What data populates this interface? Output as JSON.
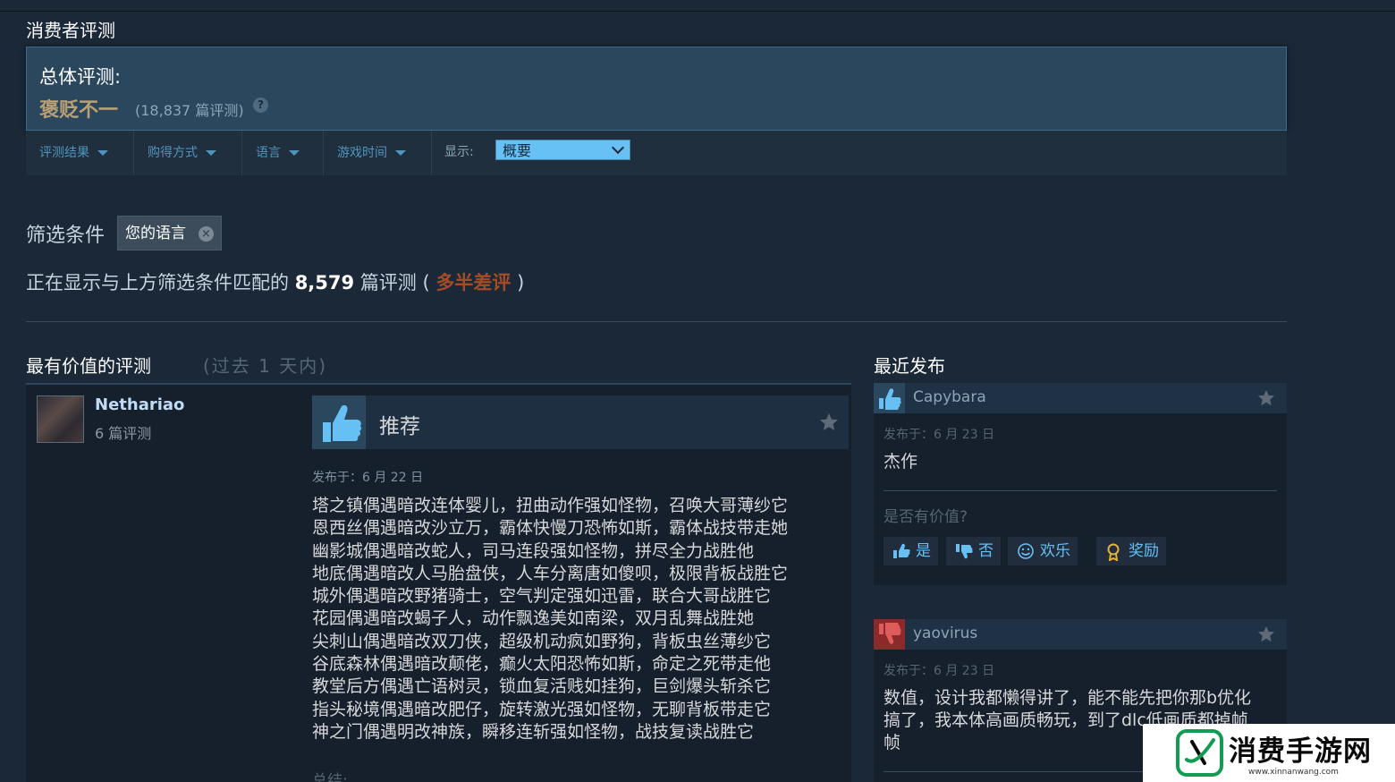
{
  "section_title": "消费者评测",
  "overall": {
    "label": "总体评测:",
    "summary": "褒贬不一",
    "count": "(18,837 篇评测)",
    "help": "?"
  },
  "filter_bar": {
    "items": [
      "评测结果",
      "购得方式",
      "语言",
      "游戏时间"
    ],
    "display_label": "显示:",
    "display_value": "概要"
  },
  "filters": {
    "label": "筛选条件",
    "chip": "您的语言",
    "chip_close": "×"
  },
  "showing": {
    "prefix": "正在显示与上方筛选条件匹配的",
    "count": "8,579",
    "unit": "篇评测 (",
    "summary": "多半差评",
    "suffix": ")"
  },
  "most_helpful": {
    "title": "最有价值的评测",
    "subtitle": "(过去 1 天内)"
  },
  "recent_title": "最近发布",
  "review": {
    "reviewer": "Nethariao",
    "reviewer_count": "6 篇评测",
    "verdict": "推荐",
    "posted": "发布于：6 月 22 日",
    "body": "塔之镇偶遇暗改连体婴儿，扭曲动作强如怪物，召唤大哥薄纱它\n恩西丝偶遇暗改沙立万，霸体快慢刀恐怖如斯，霸体战技带走她\n幽影城偶遇暗改蛇人，司马连段强如怪物，拼尽全力战胜他\n地底偶遇暗改人马胎盘侠，人车分离唐如傻呗，极限背板战胜它\n城外偶遇暗改野猪骑士，空气判定强如迅雷，联合大哥战胜它\n花园偶遇暗改蝎子人，动作飘逸美如南梁，双月乱舞战胜她\n尖刺山偶遇暗改双刀侠，超级机动疯如野狗，背板虫丝薄纱它\n谷底森林偶遇暗改颠佬，癫火太阳恐怖如斯，命定之死带走他\n教堂后方偶遇亡语树灵，锁血复活贱如挂狗，巨剑爆头斩杀它\n指头秘境偶遇暗改肥仔，旋转激光强如怪物，无聊背板带走它\n神之门偶遇明改神族，瞬移连斩强如怪物，战技复读战胜它",
    "summary_label": "总结:"
  },
  "recent": [
    {
      "name": "Capybara",
      "recommended": true,
      "posted": "发布于：6 月 23 日",
      "text": "杰作",
      "helpful_q": "是否有价值?",
      "votes": {
        "yes": "是",
        "no": "否",
        "funny": "欢乐",
        "award": "奖励"
      }
    },
    {
      "name": "yaovirus",
      "recommended": false,
      "posted": "发布于：6 月 23 日",
      "text": "数值，设计我都懒得讲了，能不能先把你那b优化\n搞了，我本体高画质畅玩，到了dlc低画质都掉帧\n帧"
    }
  ],
  "watermark": {
    "text": "消费手游网",
    "url": "www.xinnanwang.com"
  },
  "colors": {
    "background": "#1b2838",
    "mixed": "#b9a074",
    "negative": "#a34c25",
    "link": "#66c0f4"
  }
}
